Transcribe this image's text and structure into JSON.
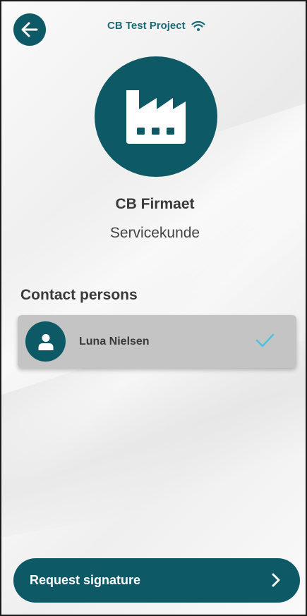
{
  "header": {
    "title": "CB Test Project",
    "back_icon": "arrow-left-icon",
    "status_icon": "wifi-icon"
  },
  "company": {
    "icon": "factory-icon",
    "name": "CB Firmaet",
    "type": "Servicekunde"
  },
  "contacts": {
    "section_title": "Contact persons",
    "items": [
      {
        "name": "Luna Nielsen",
        "avatar_icon": "person-icon",
        "selected": true,
        "check_icon": "checkmark-icon"
      }
    ]
  },
  "footer": {
    "request_label": "Request signature",
    "chevron_icon": "chevron-right-icon"
  },
  "colors": {
    "primary": "#0e5966",
    "title": "#1b6c7a",
    "check": "#4fc3d9",
    "card": "#c4c4c4"
  }
}
